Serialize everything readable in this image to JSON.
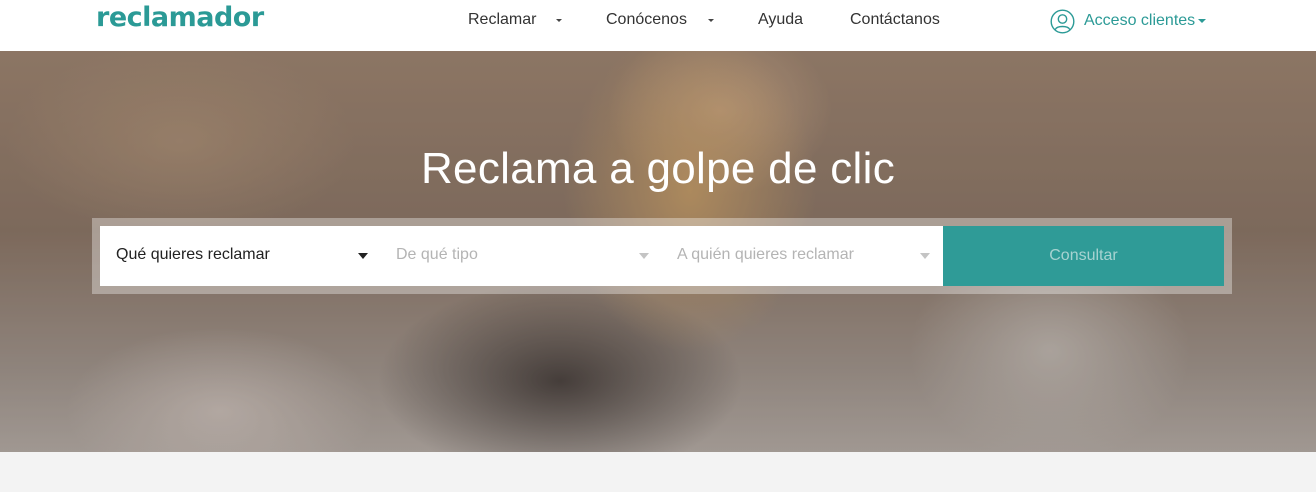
{
  "header": {
    "logo": "reclamador",
    "nav": [
      {
        "label": "Reclamar",
        "dropdown": true
      },
      {
        "label": "Conócenos",
        "dropdown": true
      },
      {
        "label": "Ayuda",
        "dropdown": false
      },
      {
        "label": "Contáctanos",
        "dropdown": false
      }
    ],
    "access_label": "Acceso clientes",
    "access_icon": "user-circle-icon"
  },
  "hero": {
    "title": "Reclama a golpe de clic",
    "search": {
      "what": "Qué quieres reclamar",
      "type_placeholder": "De qué tipo",
      "who_placeholder": "A quién quieres reclamar",
      "submit_label": "Consultar"
    }
  },
  "colors": {
    "brand": "#2b9a96",
    "button": "#2f9b97",
    "button_text": "#a7d3d1"
  }
}
